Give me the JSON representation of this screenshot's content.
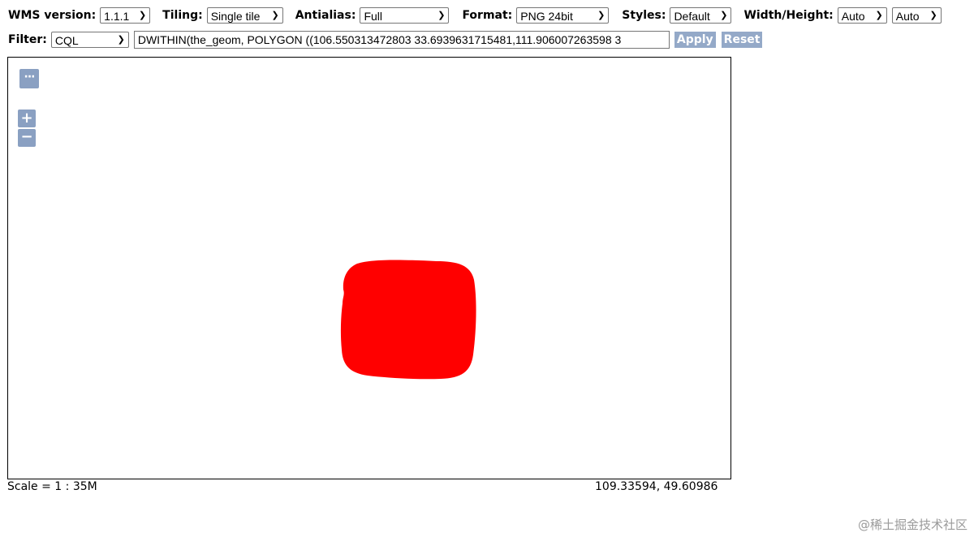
{
  "toolbar": {
    "wms_version": {
      "label": "WMS version:",
      "value": "1.1.1"
    },
    "tiling": {
      "label": "Tiling:",
      "value": "Single tile"
    },
    "antialias": {
      "label": "Antialias:",
      "value": "Full"
    },
    "format": {
      "label": "Format:",
      "value": "PNG 24bit"
    },
    "styles": {
      "label": "Styles:",
      "value": "Default"
    },
    "width_height": {
      "label": "Width/Height:",
      "width_value": "Auto",
      "height_value": "Auto"
    }
  },
  "filter": {
    "label": "Filter:",
    "type_value": "CQL",
    "expression": "DWITHIN(the_geom, POLYGON ((106.550313472803 33.6939631715481,111.906007263598 3",
    "apply_label": "Apply",
    "reset_label": "Reset"
  },
  "map": {
    "menu_icon": "···",
    "zoom_in": "+",
    "zoom_out": "−",
    "feature_color": "#ff0000"
  },
  "status": {
    "scale": "Scale = 1 : 35M",
    "coordinates": "109.33594, 49.60986"
  },
  "watermark": "@稀土掘金技术社区",
  "colors": {
    "button_bg": "#94a9c8",
    "map_control_bg": "#8aa0c2",
    "feature": "#ff0000"
  }
}
